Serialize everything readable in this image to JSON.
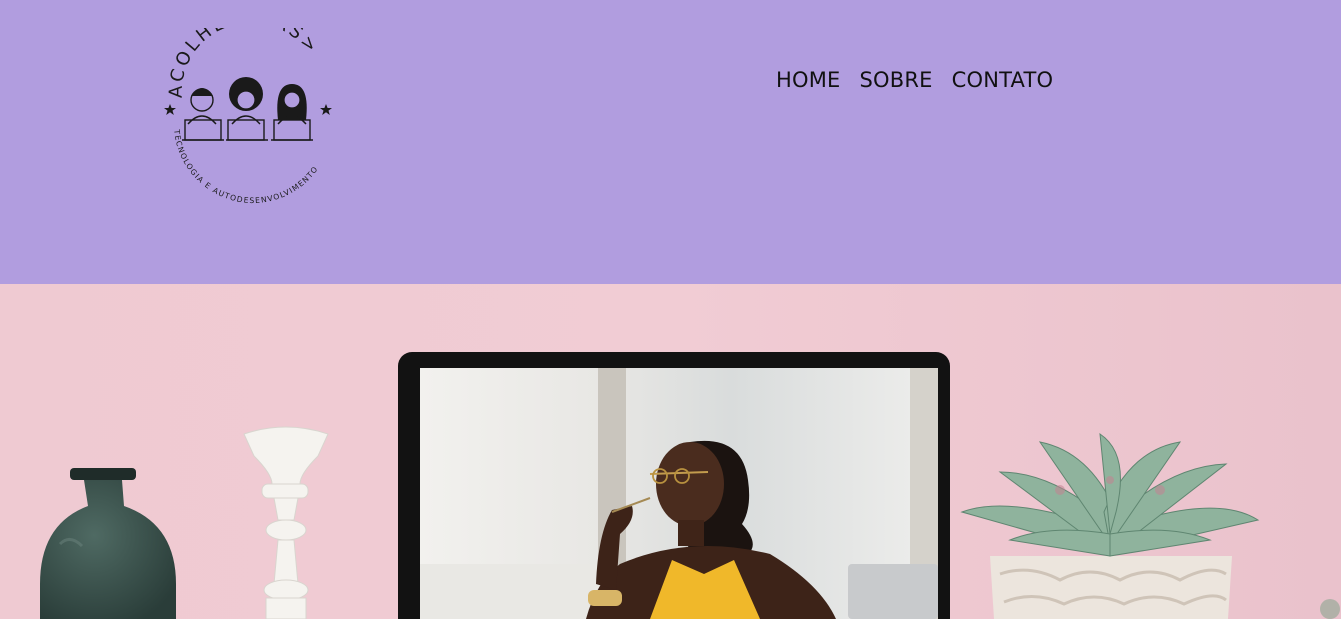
{
  "brand": {
    "name_text": "ACOLHE<ELAS>",
    "tagline_text": "TECNOLOGIA E AUTODESENVOLVIMENTO"
  },
  "nav": {
    "items": [
      {
        "label": "HOME"
      },
      {
        "label": "SOBRE"
      },
      {
        "label": "CONTATO"
      }
    ]
  },
  "colors": {
    "header_bg": "#b19ddf",
    "hero_wall": "#efc9d1",
    "nav_text": "#111111"
  },
  "hero": {
    "description_icons": [
      "vase-icon",
      "candlestick-icon",
      "laptop-icon",
      "succulent-plant-icon"
    ]
  }
}
